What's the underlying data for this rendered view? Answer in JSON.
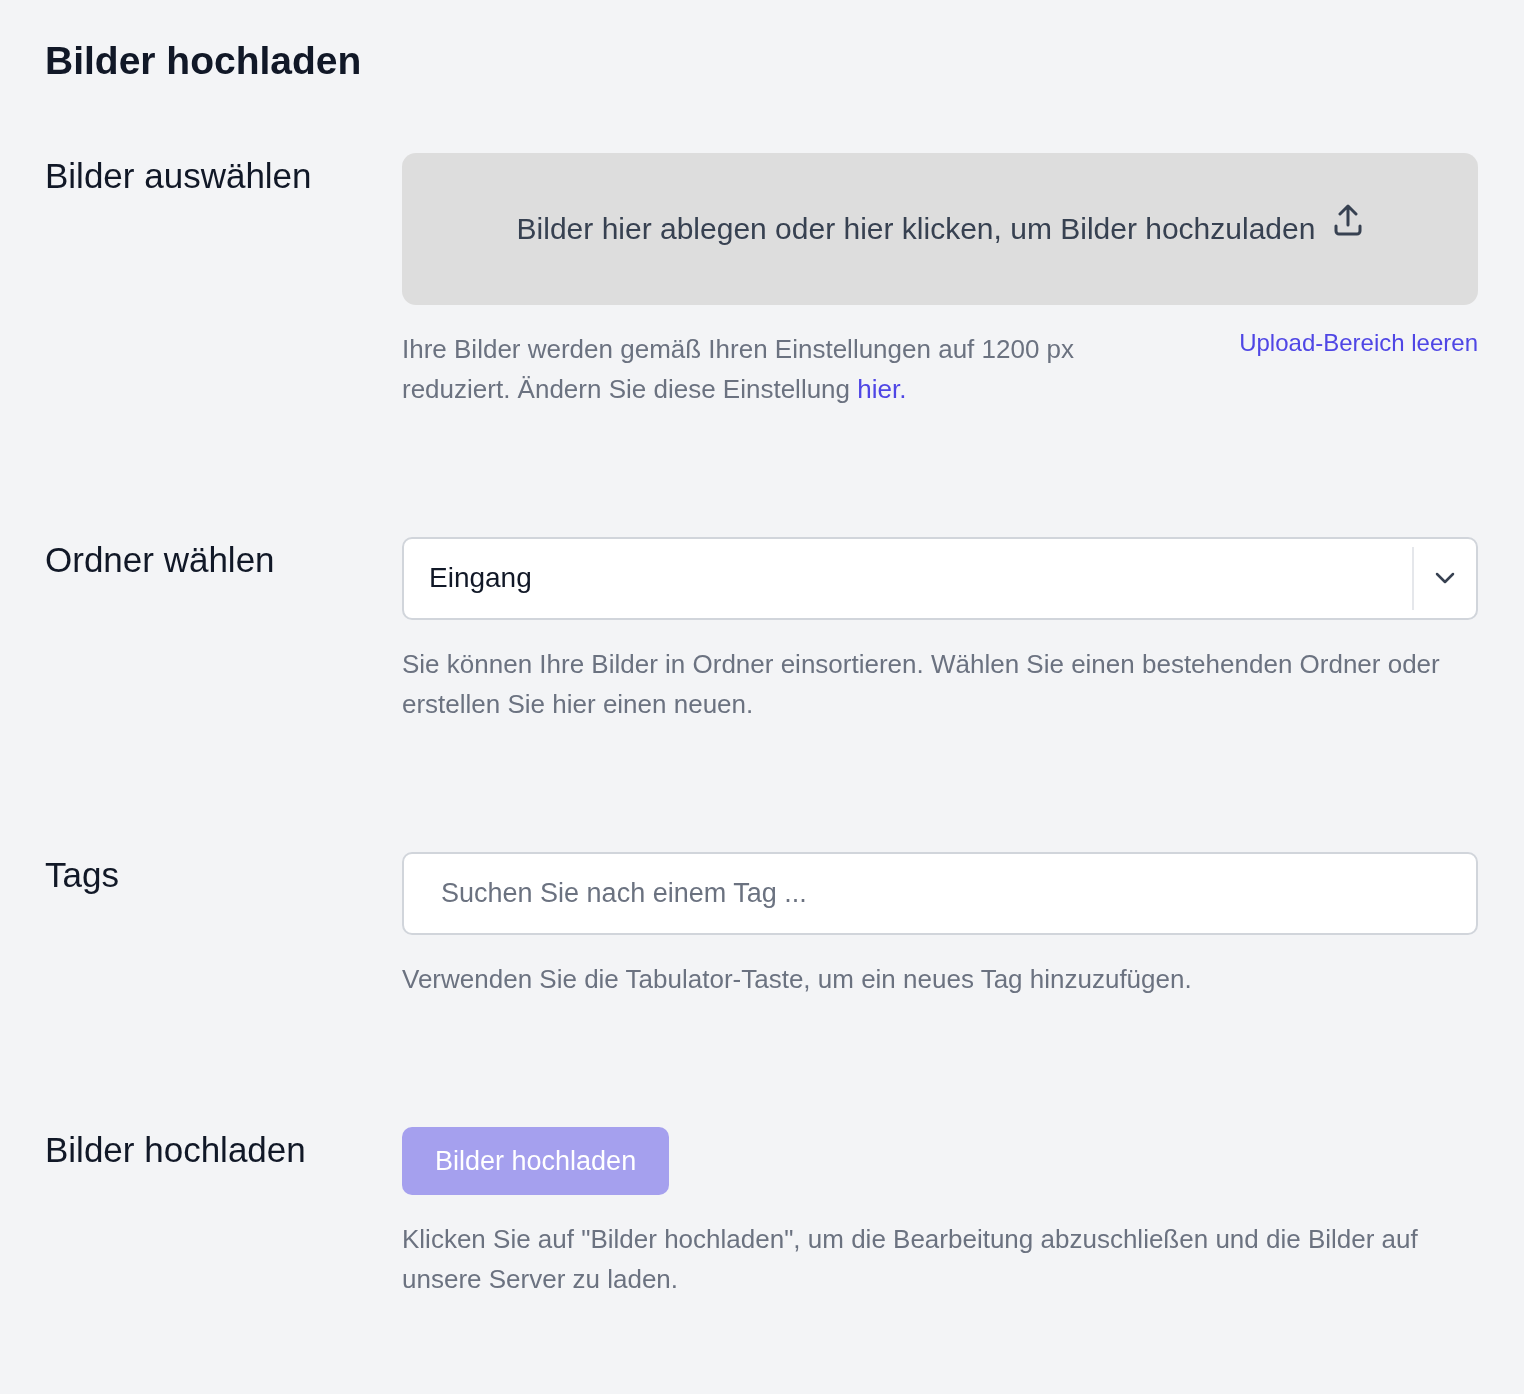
{
  "page_title": "Bilder hochladen",
  "sections": [
    {
      "kind": "dropzone",
      "label": "Bilder auswählen",
      "dropzone_text": "Bilder hier ablegen oder hier klicken, um Bilder hochzuladen",
      "help": "Ihre Bilder werden gemäß Ihren Einstellungen auf 1200 px reduziert. Ändern Sie diese Einstellung ",
      "help_link": "hier.",
      "side_link": "Upload-Bereich leeren"
    },
    {
      "kind": "select",
      "label": "Ordner wählen",
      "value": "Eingang",
      "help": "Sie können Ihre Bilder in Ordner einsortieren. Wählen Sie einen bestehenden Ordner oder erstellen Sie hier einen neuen."
    },
    {
      "kind": "tags",
      "label": "Tags",
      "placeholder": "Suchen Sie nach einem Tag ...",
      "help": "Verwenden Sie die Tabulator-Taste, um ein neues Tag hinzuzufügen."
    },
    {
      "kind": "button",
      "label": "Bilder hochladen",
      "button": "Bilder hochladen",
      "disabled": true,
      "help": "Klicken Sie auf \"Bilder hochladen\", um die Bearbeitung abzuschließen und die Bilder auf unsere Server zu laden."
    }
  ]
}
